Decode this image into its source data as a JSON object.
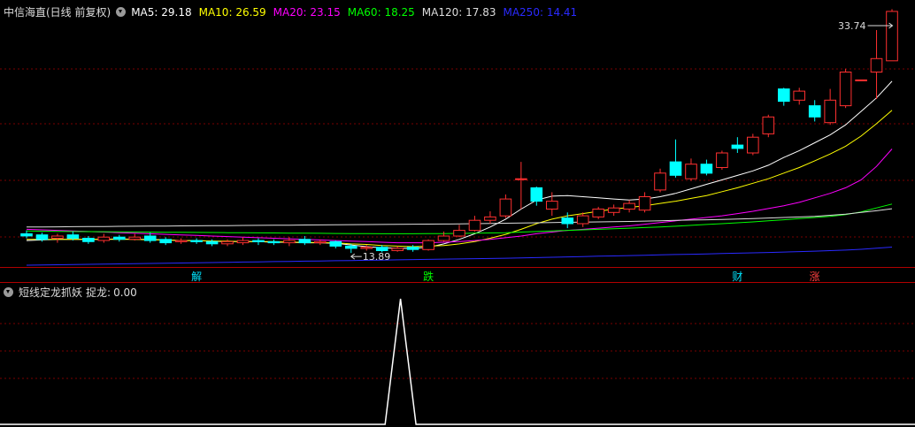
{
  "header": {
    "title": "中信海直(日线 前复权)",
    "ma": [
      {
        "label": "MA5:",
        "value": "29.18",
        "color": "#ffffff"
      },
      {
        "label": "MA10:",
        "value": "26.59",
        "color": "#ffff00"
      },
      {
        "label": "MA20:",
        "value": "23.15",
        "color": "#ff00ff"
      },
      {
        "label": "MA60:",
        "value": "18.25",
        "color": "#00ff00"
      },
      {
        "label": "MA120:",
        "value": "17.83",
        "color": "#dddddd"
      },
      {
        "label": "MA250:",
        "value": "14.41",
        "color": "#2a2aff"
      }
    ]
  },
  "indicator_header": {
    "name": "短线定龙抓妖",
    "label": "捉龙:",
    "value": "0.00"
  },
  "annotations": {
    "high": "33.74",
    "low": "13.89"
  },
  "markers": [
    {
      "text": "解",
      "color": "#00e5ff"
    },
    {
      "text": "跌",
      "color": "#00ff00"
    },
    {
      "text": "财",
      "color": "#00e5ff"
    },
    {
      "text": "涨",
      "color": "#ff4040"
    }
  ],
  "chart_data": [
    {
      "type": "candlestick",
      "title": "中信海直(日线 前复权)",
      "colors": {
        "up": "#ff3030",
        "down": "#00ffff"
      },
      "ylim": [
        12.8,
        35.0
      ],
      "candles": [
        [
          15.6,
          15.4,
          15.9,
          15.2
        ],
        [
          15.5,
          15.1,
          15.7,
          14.9
        ],
        [
          15.2,
          15.4,
          15.6,
          14.8
        ],
        [
          15.5,
          15.2,
          15.8,
          15.0
        ],
        [
          15.2,
          14.9,
          15.4,
          14.7
        ],
        [
          15.0,
          15.3,
          15.6,
          14.8
        ],
        [
          15.3,
          15.1,
          15.5,
          14.9
        ],
        [
          15.1,
          15.3,
          15.6,
          15.0
        ],
        [
          15.4,
          15.0,
          15.7,
          14.8
        ],
        [
          15.1,
          14.8,
          15.3,
          14.6
        ],
        [
          14.9,
          15.0,
          15.2,
          14.7
        ],
        [
          15.0,
          14.9,
          15.2,
          14.7
        ],
        [
          14.9,
          14.7,
          15.1,
          14.5
        ],
        [
          14.7,
          14.9,
          15.1,
          14.5
        ],
        [
          14.8,
          15.0,
          15.3,
          14.6
        ],
        [
          15.0,
          14.9,
          15.2,
          14.6
        ],
        [
          14.9,
          14.8,
          15.1,
          14.6
        ],
        [
          14.8,
          15.0,
          15.3,
          14.5
        ],
        [
          15.1,
          14.8,
          15.4,
          14.6
        ],
        [
          14.8,
          14.9,
          15.1,
          14.6
        ],
        [
          14.9,
          14.5,
          15.0,
          14.3
        ],
        [
          14.5,
          14.3,
          14.7,
          13.89
        ],
        [
          14.3,
          14.4,
          14.6,
          14.1
        ],
        [
          14.4,
          14.1,
          14.6,
          13.95
        ],
        [
          14.1,
          14.3,
          14.5,
          14.0
        ],
        [
          14.4,
          14.2,
          14.6,
          14.0
        ],
        [
          14.2,
          15.0,
          15.1,
          14.1
        ],
        [
          15.0,
          15.4,
          15.8,
          14.9
        ],
        [
          15.4,
          15.9,
          16.4,
          15.3
        ],
        [
          15.9,
          16.8,
          17.2,
          15.8
        ],
        [
          16.8,
          17.1,
          17.6,
          16.5
        ],
        [
          17.2,
          18.7,
          19.1,
          17.0
        ],
        [
          20.5,
          20.5,
          22.0,
          17.8
        ],
        [
          19.7,
          18.5,
          19.8,
          18.1
        ],
        [
          17.8,
          18.5,
          19.3,
          17.2
        ],
        [
          17.0,
          16.5,
          17.5,
          16.1
        ],
        [
          16.5,
          17.2,
          17.5,
          16.2
        ],
        [
          17.1,
          17.8,
          18.0,
          16.9
        ],
        [
          17.5,
          17.9,
          18.2,
          17.2
        ],
        [
          17.8,
          18.3,
          18.6,
          17.5
        ],
        [
          17.7,
          18.9,
          19.3,
          17.5
        ],
        [
          19.5,
          21.0,
          21.4,
          19.3
        ],
        [
          22.0,
          20.8,
          24.0,
          20.6
        ],
        [
          20.5,
          21.8,
          22.3,
          20.3
        ],
        [
          21.8,
          21.0,
          22.2,
          20.8
        ],
        [
          21.5,
          22.8,
          23.0,
          21.3
        ],
        [
          23.5,
          23.2,
          24.2,
          22.8
        ],
        [
          22.8,
          24.2,
          24.5,
          22.6
        ],
        [
          24.5,
          26.0,
          26.2,
          24.2
        ],
        [
          28.5,
          27.4,
          28.6,
          27.0
        ],
        [
          27.5,
          28.3,
          28.6,
          27.1
        ],
        [
          27.0,
          26.0,
          27.5,
          25.6
        ],
        [
          25.5,
          27.5,
          28.5,
          25.3
        ],
        [
          27.0,
          30.0,
          30.3,
          26.8
        ],
        [
          29.3,
          29.3,
          29.3,
          29.3
        ],
        [
          30.0,
          31.2,
          33.74,
          27.6
        ],
        [
          31.0,
          35.4,
          35.6,
          31.0
        ]
      ],
      "series": [
        {
          "name": "MA5",
          "color": "#ffffff",
          "values": [
            15.0,
            15.05,
            15.1,
            15.1,
            15.1,
            15.1,
            15.15,
            15.1,
            15.1,
            15.05,
            15.0,
            15.0,
            14.95,
            14.9,
            14.9,
            14.9,
            14.85,
            14.85,
            14.8,
            14.8,
            14.75,
            14.6,
            14.45,
            14.35,
            14.3,
            14.3,
            14.4,
            14.7,
            15.1,
            15.6,
            16.2,
            16.9,
            17.8,
            18.6,
            18.95,
            19.0,
            18.9,
            18.8,
            18.7,
            18.6,
            18.7,
            18.9,
            19.2,
            19.6,
            20.0,
            20.4,
            20.8,
            21.2,
            21.7,
            22.4,
            23.0,
            23.7,
            24.4,
            25.3,
            26.5,
            27.7,
            29.18
          ]
        },
        {
          "name": "MA10",
          "color": "#ffff00",
          "values": [
            15.1,
            15.1,
            15.1,
            15.1,
            15.1,
            15.1,
            15.1,
            15.1,
            15.05,
            15.05,
            15.0,
            15.0,
            14.95,
            14.95,
            14.9,
            14.9,
            14.9,
            14.85,
            14.85,
            14.8,
            14.8,
            14.7,
            14.65,
            14.55,
            14.5,
            14.45,
            14.5,
            14.55,
            14.7,
            14.9,
            15.2,
            15.55,
            16.0,
            16.5,
            16.9,
            17.2,
            17.4,
            17.6,
            17.8,
            17.95,
            18.1,
            18.3,
            18.5,
            18.75,
            19.0,
            19.35,
            19.7,
            20.1,
            20.5,
            21.0,
            21.5,
            22.1,
            22.7,
            23.4,
            24.3,
            25.4,
            26.59
          ]
        },
        {
          "name": "MA20",
          "color": "#ff00ff",
          "values": [
            16.0,
            15.95,
            15.9,
            15.85,
            15.8,
            15.75,
            15.7,
            15.65,
            15.6,
            15.55,
            15.5,
            15.45,
            15.4,
            15.35,
            15.3,
            15.25,
            15.2,
            15.15,
            15.1,
            15.05,
            15.0,
            14.95,
            14.9,
            14.85,
            14.8,
            14.8,
            14.8,
            14.85,
            14.9,
            15.0,
            15.1,
            15.25,
            15.4,
            15.6,
            15.75,
            15.9,
            16.0,
            16.1,
            16.2,
            16.3,
            16.45,
            16.6,
            16.75,
            16.9,
            17.05,
            17.2,
            17.4,
            17.6,
            17.85,
            18.1,
            18.4,
            18.8,
            19.2,
            19.7,
            20.4,
            21.6,
            23.15
          ]
        },
        {
          "name": "MA60",
          "color": "#00ff00",
          "values": [
            15.85,
            15.83,
            15.81,
            15.8,
            15.79,
            15.78,
            15.77,
            15.76,
            15.75,
            15.74,
            15.73,
            15.72,
            15.71,
            15.7,
            15.69,
            15.68,
            15.67,
            15.66,
            15.65,
            15.64,
            15.63,
            15.62,
            15.61,
            15.6,
            15.6,
            15.6,
            15.61,
            15.62,
            15.63,
            15.65,
            15.67,
            15.7,
            15.75,
            15.8,
            15.85,
            15.9,
            15.95,
            16.0,
            16.05,
            16.1,
            16.15,
            16.2,
            16.27,
            16.35,
            16.43,
            16.5,
            16.58,
            16.66,
            16.75,
            16.85,
            16.95,
            17.05,
            17.15,
            17.3,
            17.55,
            17.9,
            18.25
          ]
        },
        {
          "name": "MA120",
          "color": "#dddddd",
          "values": [
            16.2,
            16.21,
            16.22,
            16.23,
            16.24,
            16.25,
            16.26,
            16.27,
            16.28,
            16.29,
            16.3,
            16.31,
            16.32,
            16.33,
            16.34,
            16.35,
            16.36,
            16.37,
            16.38,
            16.39,
            16.4,
            16.41,
            16.42,
            16.43,
            16.44,
            16.45,
            16.46,
            16.47,
            16.48,
            16.5,
            16.52,
            16.54,
            16.56,
            16.58,
            16.6,
            16.62,
            16.64,
            16.66,
            16.68,
            16.7,
            16.73,
            16.76,
            16.79,
            16.82,
            16.85,
            16.88,
            16.92,
            16.96,
            17.0,
            17.05,
            17.1,
            17.15,
            17.25,
            17.35,
            17.5,
            17.65,
            17.83
          ]
        },
        {
          "name": "MA250",
          "color": "#2a2aff",
          "values": [
            12.8,
            12.82,
            12.84,
            12.86,
            12.88,
            12.9,
            12.92,
            12.94,
            12.96,
            12.98,
            13.0,
            13.02,
            13.04,
            13.06,
            13.08,
            13.1,
            13.12,
            13.14,
            13.16,
            13.18,
            13.2,
            13.22,
            13.24,
            13.26,
            13.28,
            13.3,
            13.32,
            13.34,
            13.36,
            13.38,
            13.4,
            13.42,
            13.45,
            13.48,
            13.51,
            13.54,
            13.57,
            13.6,
            13.63,
            13.66,
            13.69,
            13.72,
            13.75,
            13.78,
            13.81,
            13.84,
            13.87,
            13.9,
            13.93,
            13.97,
            14.01,
            14.05,
            14.1,
            14.15,
            14.22,
            14.31,
            14.41
          ]
        }
      ]
    },
    {
      "type": "line",
      "title": "短线定龙抓妖",
      "ylim": [
        0,
        1
      ],
      "series": [
        {
          "name": "捉龙",
          "color": "#ffffff",
          "values": [
            0,
            0,
            0,
            0,
            0,
            0,
            0,
            0,
            0,
            0,
            0,
            0,
            0,
            0,
            0,
            0,
            0,
            0,
            0,
            0,
            0,
            0,
            0,
            0,
            0,
            0,
            0,
            0,
            0,
            0,
            0,
            0,
            0,
            0,
            0,
            0,
            0,
            0,
            0,
            0,
            0,
            0,
            0,
            0,
            0,
            0,
            0,
            0,
            0,
            0,
            0,
            0,
            0,
            0,
            0,
            0,
            0
          ]
        }
      ],
      "spikes": [
        {
          "index": 24.2,
          "value": 1
        }
      ]
    }
  ]
}
